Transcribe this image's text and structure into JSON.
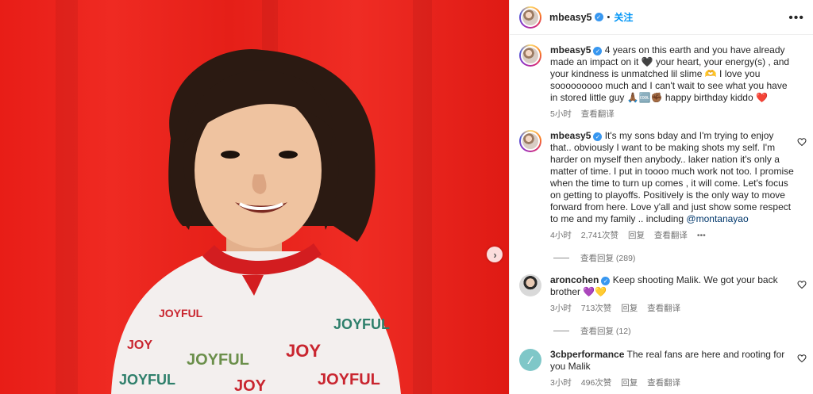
{
  "colors": {
    "accent": "#0095f6",
    "media_background": "#e81d17",
    "verified": "#3897f0",
    "meta_text": "#737373"
  },
  "header": {
    "username": "mbeasy5",
    "separator": "•",
    "follow_label": "关注",
    "more_icon": "more-horizontal-icon"
  },
  "media": {
    "next_icon": "chevron-right-icon"
  },
  "caption": {
    "username": "mbeasy5",
    "text": "4 years on this earth and you have already made an impact on it 🖤 your heart, your energy(s) , and your kindness is unmatched lil slime 🫶 I love you sooooooooo much and I can't wait to see what you have in stored little guy 🙏🏾🆒✊🏾 happy birthday kiddo ❤️",
    "time": "5小时",
    "translate": "查看翻译"
  },
  "comments": [
    {
      "username": "mbeasy5",
      "text": "It's my sons bday and I'm trying to enjoy that.. obviously I want to be making shots my self. I'm harder on myself then anybody.. laker nation it's only a matter of time. I put in toooo much work not too. I promise when the time to turn up comes , it will come. Let's focus on getting to playoffs. Positively is the only way to move forward from here. Love y'all and just show some respect to me and my family .. including",
      "mention": "@montanayao",
      "time": "4小时",
      "likes": "2,741次赞",
      "reply": "回复",
      "translate": "查看翻译",
      "more": "•••",
      "view_replies": "查看回复 (289)"
    },
    {
      "username": "aroncohen",
      "text": "Keep shooting Malik. We got your back brother",
      "emojis": "💜💛",
      "time": "3小时",
      "likes": "713次赞",
      "reply": "回复",
      "translate": "查看翻译",
      "view_replies": "查看回复 (12)"
    },
    {
      "username": "3cbperformance",
      "text": "The real fans are here and rooting for you Malik",
      "time": "3小时",
      "likes": "496次赞",
      "reply": "回复",
      "translate": "查看翻译"
    }
  ],
  "photo_print": {
    "joy": "JOY",
    "joyful": "JOYFUL"
  }
}
